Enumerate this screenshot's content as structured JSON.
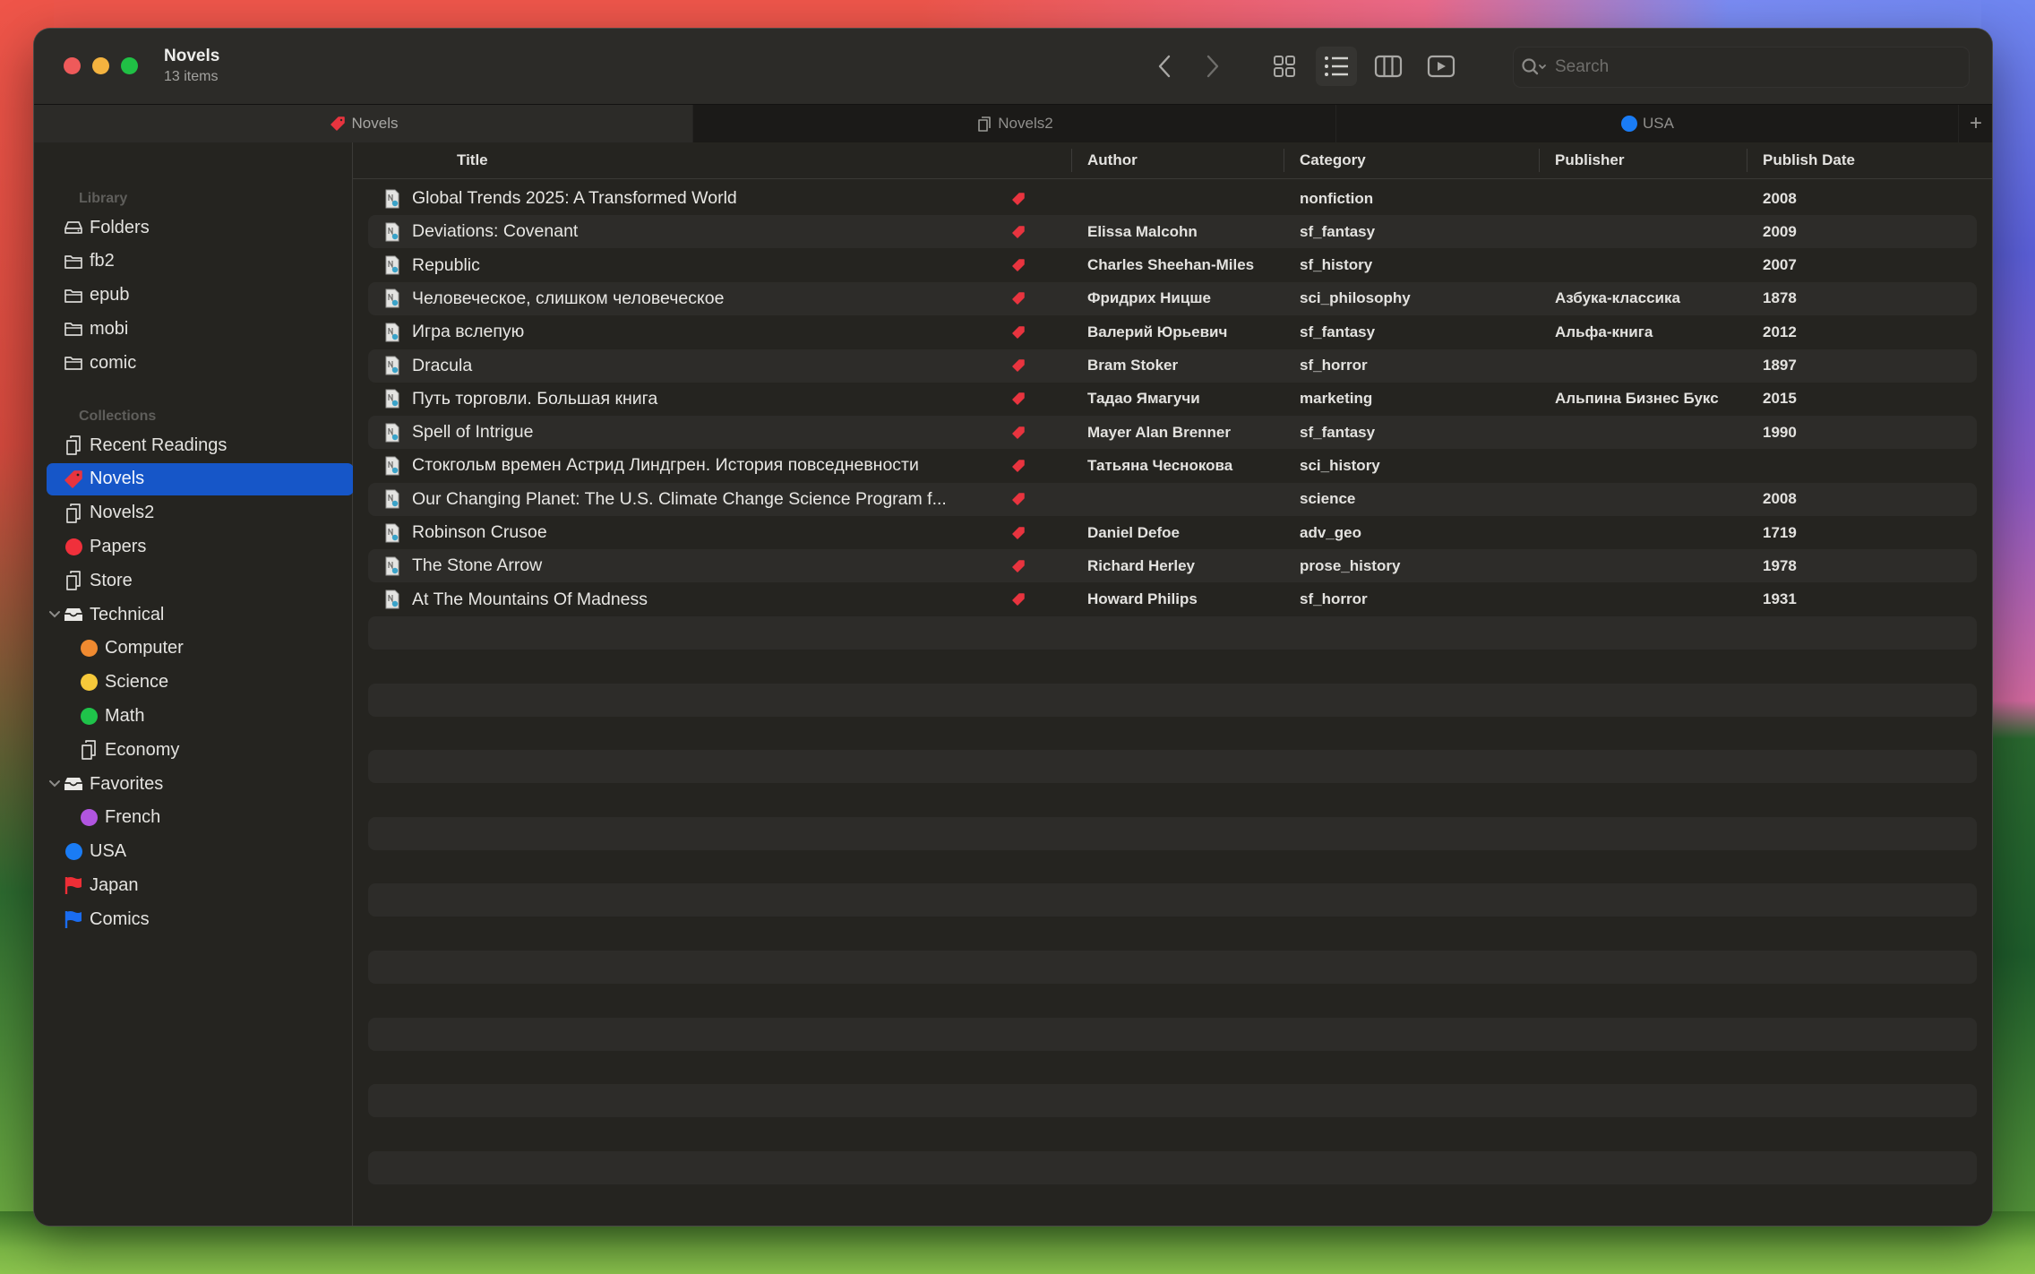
{
  "window": {
    "title": "Novels",
    "subtitle": "13 items"
  },
  "toolbar": {
    "back_icon": "chevron-left-icon",
    "forward_icon": "chevron-right-icon",
    "view_modes": [
      "grid-view-icon",
      "list-view-icon",
      "column-view-icon",
      "slideshow-icon"
    ],
    "active_view": "list",
    "search": {
      "placeholder": "Search",
      "value": ""
    }
  },
  "tabs": [
    {
      "label": "Novels",
      "icon": "tag-icon",
      "icon_color": "#e8343f",
      "active": true
    },
    {
      "label": "Novels2",
      "icon": "documents-icon",
      "active": false
    },
    {
      "label": "USA",
      "icon": "dot-icon",
      "icon_color": "#1a7cf5",
      "active": false
    }
  ],
  "tab_add_label": "+",
  "sidebar": {
    "library_label": "Library",
    "library": [
      {
        "label": "Folders",
        "icon": "drive-icon"
      },
      {
        "label": "fb2",
        "icon": "folder-icon"
      },
      {
        "label": "epub",
        "icon": "folder-icon"
      },
      {
        "label": "mobi",
        "icon": "folder-icon"
      },
      {
        "label": "comic",
        "icon": "folder-icon"
      }
    ],
    "collections_label": "Collections",
    "collections": [
      {
        "label": "Recent Readings",
        "icon": "documents-icon",
        "level": 0
      },
      {
        "label": "Novels",
        "icon": "tag-icon",
        "color": "#e8343f",
        "level": 0,
        "selected": true
      },
      {
        "label": "Novels2",
        "icon": "documents-icon",
        "level": 0
      },
      {
        "label": "Papers",
        "icon": "dot-icon",
        "color": "#f0303b",
        "level": 0
      },
      {
        "label": "Store",
        "icon": "documents-icon",
        "level": 0
      },
      {
        "label": "Technical",
        "icon": "tray-icon",
        "level": 0,
        "expanded": true
      },
      {
        "label": "Computer",
        "icon": "dot-icon",
        "color": "#f08a30",
        "level": 1
      },
      {
        "label": "Science",
        "icon": "dot-icon",
        "color": "#f6c93a",
        "level": 1
      },
      {
        "label": "Math",
        "icon": "dot-icon",
        "color": "#1fc34a",
        "level": 1
      },
      {
        "label": "Economy",
        "icon": "documents-icon",
        "level": 1
      },
      {
        "label": "Favorites",
        "icon": "tray-icon",
        "level": 0,
        "expanded": true
      },
      {
        "label": "French",
        "icon": "dot-icon",
        "color": "#b155e0",
        "level": 1
      },
      {
        "label": "USA",
        "icon": "dot-icon",
        "color": "#1a7cf5",
        "level": 0
      },
      {
        "label": "Japan",
        "icon": "flag-icon",
        "color": "#ee2e36",
        "level": 0
      },
      {
        "label": "Comics",
        "icon": "flag-icon",
        "color": "#1a6cf0",
        "level": 0
      }
    ]
  },
  "table": {
    "columns": [
      "Title",
      "Author",
      "Category",
      "Publisher",
      "Publish Date"
    ],
    "rows": [
      {
        "title": "Global Trends 2025: A Transformed World",
        "author": "",
        "category": "nonfiction",
        "publisher": "",
        "date": "2008"
      },
      {
        "title": "Deviations: Covenant",
        "author": "Elissa Malcohn",
        "category": "sf_fantasy",
        "publisher": "",
        "date": "2009"
      },
      {
        "title": "Republic",
        "author": "Charles Sheehan-Miles",
        "category": "sf_history",
        "publisher": "",
        "date": "2007"
      },
      {
        "title": "Человеческое, слишком человеческое",
        "author": "Фридрих Ницше",
        "category": "sci_philosophy",
        "publisher": "Азбука-классика",
        "date": "1878"
      },
      {
        "title": "Игра вслепую",
        "author": "Валерий Юрьевич",
        "category": "sf_fantasy",
        "publisher": "Альфа-книга",
        "date": "2012"
      },
      {
        "title": "Dracula",
        "author": "Bram Stoker",
        "category": "sf_horror",
        "publisher": "",
        "date": "1897"
      },
      {
        "title": "Путь торговли. Большая книга",
        "author": "Тадао Ямагучи",
        "category": "marketing",
        "publisher": "Альпина Бизнес Букс",
        "date": "2015"
      },
      {
        "title": "Spell of Intrigue",
        "author": "Mayer Alan Brenner",
        "category": "sf_fantasy",
        "publisher": "",
        "date": "1990"
      },
      {
        "title": "Стокгольм времен Астрид Линдгрен. История повседневности",
        "author": "Татьяна Чеснокова",
        "category": "sci_history",
        "publisher": "",
        "date": ""
      },
      {
        "title": "Our Changing Planet: The U.S. Climate Change Science Program f...",
        "author": "",
        "category": "science",
        "publisher": "",
        "date": "2008"
      },
      {
        "title": "Robinson Crusoe",
        "author": "Daniel Defoe",
        "category": "adv_geo",
        "publisher": "",
        "date": "1719"
      },
      {
        "title": "The Stone Arrow",
        "author": "Richard Herley",
        "category": "prose_history",
        "publisher": "",
        "date": "1978"
      },
      {
        "title": "At The Mountains Of Madness",
        "author": "Howard Philips",
        "category": "sf_horror",
        "publisher": "",
        "date": "1931"
      }
    ],
    "row_tag_color": "#e8343f"
  }
}
